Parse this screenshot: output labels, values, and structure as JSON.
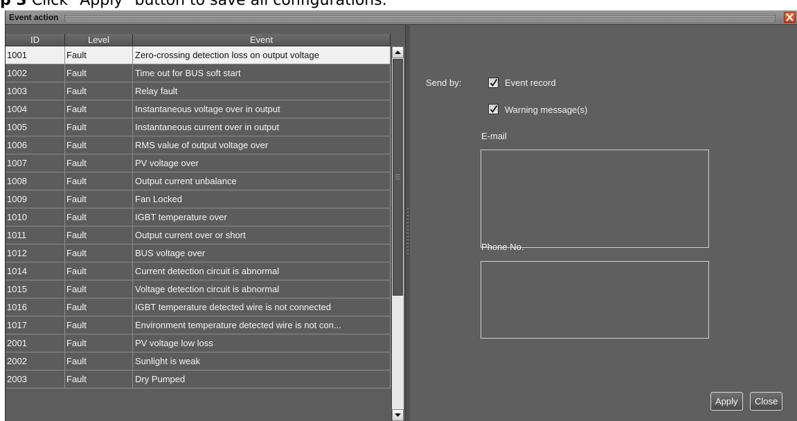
{
  "caption": {
    "step": "p 3",
    "text": "Click \"Apply\" button to save all configurations."
  },
  "window": {
    "title": "Event action"
  },
  "table": {
    "columns": [
      "ID",
      "Level",
      "Event"
    ],
    "rows": [
      {
        "id": "1001",
        "level": "Fault",
        "event": "Zero-crossing detection loss on output voltage"
      },
      {
        "id": "1002",
        "level": "Fault",
        "event": "Time out for BUS soft start"
      },
      {
        "id": "1003",
        "level": "Fault",
        "event": "Relay fault"
      },
      {
        "id": "1004",
        "level": "Fault",
        "event": "Instantaneous voltage over in output"
      },
      {
        "id": "1005",
        "level": "Fault",
        "event": "Instantaneous current over in output"
      },
      {
        "id": "1006",
        "level": "Fault",
        "event": "RMS value of output voltage over"
      },
      {
        "id": "1007",
        "level": "Fault",
        "event": "PV voltage over"
      },
      {
        "id": "1008",
        "level": "Fault",
        "event": "Output current unbalance"
      },
      {
        "id": "1009",
        "level": "Fault",
        "event": "Fan Locked"
      },
      {
        "id": "1010",
        "level": "Fault",
        "event": "IGBT temperature over"
      },
      {
        "id": "1011",
        "level": "Fault",
        "event": "Output current over or short"
      },
      {
        "id": "1012",
        "level": "Fault",
        "event": "BUS voltage over"
      },
      {
        "id": "1014",
        "level": "Fault",
        "event": "Current detection circuit is abnormal"
      },
      {
        "id": "1015",
        "level": "Fault",
        "event": "Voltage detection circuit is abnormal"
      },
      {
        "id": "1016",
        "level": "Fault",
        "event": "IGBT temperature detected wire is not connected"
      },
      {
        "id": "1017",
        "level": "Fault",
        "event": "Environment temperature detected wire is not con..."
      },
      {
        "id": "2001",
        "level": "Fault",
        "event": "PV voltage low loss"
      },
      {
        "id": "2002",
        "level": "Fault",
        "event": "Sunlight is weak"
      },
      {
        "id": "2003",
        "level": "Fault",
        "event": "Dry Pumped"
      }
    ],
    "selected_index": 0
  },
  "panel": {
    "send_by_label": "Send by:",
    "event_record": {
      "label": "Event record",
      "checked": true
    },
    "warning_message": {
      "label": "Warning message(s)",
      "checked": true
    },
    "email_label": "E-mail",
    "email_value": "",
    "phone_label": "Phone No.",
    "phone_value": "",
    "apply_label": "Apply",
    "close_label": "Close"
  },
  "colors": {
    "window_bg": "#5b5b5b",
    "selected_row_bg": "#f0f0f0",
    "close_button": "#e0521f"
  },
  "icons": {
    "close": "close-icon",
    "scroll_up": "scroll-up-arrow-icon",
    "scroll_down": "scroll-down-arrow-icon",
    "checkmark": "checkmark-icon"
  }
}
